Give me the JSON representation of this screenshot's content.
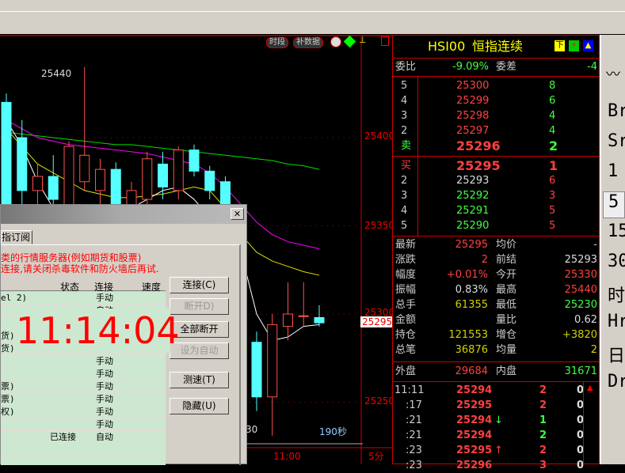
{
  "chart": {
    "btn_period": "时段",
    "btn_fill": "补数据",
    "price_labels": [
      "25400",
      "25350",
      "25300",
      "25250"
    ],
    "current_price": "25295",
    "high_label": "25440",
    "low_fragment": "30",
    "countdown": "190秒",
    "time_label": "11:00",
    "period": "5分"
  },
  "chart_data": {
    "type": "candlestick",
    "symbol": "HSI00",
    "ylim": [
      25220,
      25460
    ],
    "candles": [
      [
        25420,
        25425,
        25320,
        25330
      ],
      [
        25400,
        25410,
        25360,
        25370
      ],
      [
        25370,
        25385,
        25350,
        25378
      ],
      [
        25378,
        25390,
        25360,
        25365
      ],
      [
        25360,
        25398,
        25355,
        25395
      ],
      [
        25375,
        25440,
        25370,
        25390
      ],
      [
        25370,
        25388,
        25360,
        25382
      ],
      [
        25382,
        25386,
        25355,
        25360
      ],
      [
        25360,
        25375,
        25350,
        25370
      ],
      [
        25365,
        25392,
        25360,
        25388
      ],
      [
        25385,
        25392,
        25365,
        25372
      ],
      [
        25370,
        25395,
        25365,
        25393
      ],
      [
        25393,
        25396,
        25378,
        25381
      ],
      [
        25381,
        25384,
        25365,
        25370
      ],
      [
        25375,
        25378,
        25340,
        25345
      ],
      [
        25345,
        25350,
        25305,
        25310
      ],
      [
        25284,
        25290,
        25245,
        25253
      ],
      [
        25253,
        25300,
        25231,
        25294
      ],
      [
        25293,
        25318,
        25285,
        25300
      ],
      [
        25299,
        25318,
        25293,
        25299
      ],
      [
        25298,
        25305,
        25293,
        25295
      ]
    ],
    "ma": [
      {
        "color": "#00e000",
        "values": [
          25403,
          25402,
          25401,
          25400,
          25399,
          25398,
          25397,
          25396,
          25396,
          25395,
          25394,
          25393,
          25392,
          25391,
          25390,
          25389,
          25388,
          25387,
          25385,
          25384,
          25382
        ]
      },
      {
        "color": "#ff00ff",
        "values": [
          25410,
          25405,
          25400,
          25398,
          25396,
          25395,
          25394,
          25393,
          25392,
          25391,
          25389,
          25387,
          25385,
          25380,
          25372,
          25362,
          25352,
          25345,
          25341,
          25339,
          25337
        ]
      },
      {
        "color": "#e0e000",
        "values": [
          25405,
          25395,
          25385,
          25380,
          25375,
          25370,
          25368,
          25366,
          25366,
          25367,
          25368,
          25370,
          25372,
          25370,
          25360,
          25345,
          25335,
          25330,
          25327,
          25324,
          25322
        ]
      },
      {
        "color": "#ffffff",
        "values": [
          25410,
          25395,
          25375,
          25360,
          25350,
          25345,
          25343,
          25350,
          25360,
          25365,
          25370,
          25372,
          25365,
          25355,
          25345,
          25335,
          25300,
          25285,
          25287,
          25293,
          25294
        ]
      }
    ]
  },
  "dialog": {
    "tab": "指订阅",
    "notice1": "类的行情服务器(例如期货和股票)",
    "notice2": "连接,请关闭杀毒软件和防火墙后再试.",
    "headers": [
      "状态",
      "连接",
      "速度"
    ],
    "rows": [
      {
        "name": "el 2)",
        "status": "",
        "conn": "手动"
      },
      {
        "name": "",
        "status": "",
        "conn": "自动"
      },
      {
        "name": "",
        "status": "",
        "conn": ""
      },
      {
        "name": "货)",
        "status": "",
        "conn": ""
      },
      {
        "name": "货)",
        "status": "",
        "conn": ""
      },
      {
        "name": "",
        "status": "",
        "conn": "手动"
      },
      {
        "name": "",
        "status": "",
        "conn": "手动"
      },
      {
        "name": "票)",
        "status": "",
        "conn": "手动"
      },
      {
        "name": "票)",
        "status": "",
        "conn": "手动"
      },
      {
        "name": "权)",
        "status": "",
        "conn": "手动"
      },
      {
        "name": "",
        "status": "",
        "conn": "手动"
      },
      {
        "name": "",
        "status": "已连接",
        "conn": "自动"
      },
      {
        "name": "",
        "status": "",
        "conn": ""
      }
    ],
    "buttons": {
      "connect": "连接(C)",
      "disconnect": "断开D)",
      "disconnect_all": "全部断开",
      "set_auto": "设为自动",
      "speed_test": "测速(T)",
      "hide": "隐藏(U)"
    },
    "close": "✕"
  },
  "clock": "11:14:04",
  "quote": {
    "symbol": "HSI00",
    "name": "恒指连续",
    "icons": [
      "下",
      "⚡",
      "▲"
    ],
    "weibi_label": "委比",
    "weibi": "-9.09%",
    "weicha_label": "委差",
    "weicha": "-4",
    "asks": [
      {
        "lv": "5",
        "p": "25300",
        "v": "8"
      },
      {
        "lv": "4",
        "p": "25299",
        "v": "6"
      },
      {
        "lv": "3",
        "p": "25298",
        "v": "4"
      },
      {
        "lv": "2",
        "p": "25297",
        "v": "4"
      },
      {
        "lv": "卖",
        "p": "25296",
        "v": "2"
      }
    ],
    "bids": [
      {
        "lv": "买",
        "p": "25295",
        "v": "1"
      },
      {
        "lv": "2",
        "p": "25293",
        "v": "6"
      },
      {
        "lv": "3",
        "p": "25292",
        "v": "3"
      },
      {
        "lv": "4",
        "p": "25291",
        "v": "5"
      },
      {
        "lv": "5",
        "p": "25290",
        "v": "5"
      }
    ],
    "stats": [
      [
        "最新",
        "25295",
        "#ff4040",
        "均价",
        "-",
        "#ccc"
      ],
      [
        "涨跌",
        "2",
        "#ff4040",
        "前结",
        "25293",
        "#ddd"
      ],
      [
        "幅度",
        "+0.01%",
        "#ff4040",
        "今开",
        "25330",
        "#ff4040"
      ],
      [
        "振幅",
        "0.83%",
        "#ddd",
        "最高",
        "25440",
        "#ff4040"
      ],
      [
        "总手",
        "61355",
        "#d0d000",
        "最低",
        "25230",
        "#40ff40"
      ],
      [
        "金额",
        "",
        "#ccc",
        "量比",
        "0.62",
        "#ddd"
      ],
      [
        "持仓",
        "121553",
        "#d0d000",
        "增仓",
        "+3820",
        "#d0d000"
      ],
      [
        "总笔",
        "36876",
        "#d0d000",
        "均量",
        "2",
        "#d0d000"
      ]
    ],
    "outer_label": "外盘",
    "outer": "29684",
    "inner_label": "内盘",
    "inner": "31671",
    "ticks": [
      {
        "t": "11:11",
        "p": "25294",
        "a": "",
        "v": "2",
        "vc": "#ff4040",
        "o": "0"
      },
      {
        "t": ":17",
        "p": "25295",
        "a": "",
        "v": "2",
        "vc": "#ff4040",
        "o": "0"
      },
      {
        "t": ":21",
        "p": "25294",
        "a": "↓",
        "v": "1",
        "vc": "#40ff40",
        "o": "0"
      },
      {
        "t": ":21",
        "p": "25294",
        "a": "",
        "v": "2",
        "vc": "#40ff40",
        "o": "0"
      },
      {
        "t": ":23",
        "p": "25295",
        "a": "↑",
        "v": "2",
        "vc": "#ff4040",
        "o": "0"
      },
      {
        "t": ":23",
        "p": "25296",
        "a": "",
        "v": "3",
        "vc": "#ff4040",
        "o": "0"
      }
    ]
  },
  "right_toolbar": [
    "Br",
    "Sr",
    "1",
    "5",
    "15",
    "30",
    "时",
    "Hr",
    "日",
    "Dr"
  ]
}
